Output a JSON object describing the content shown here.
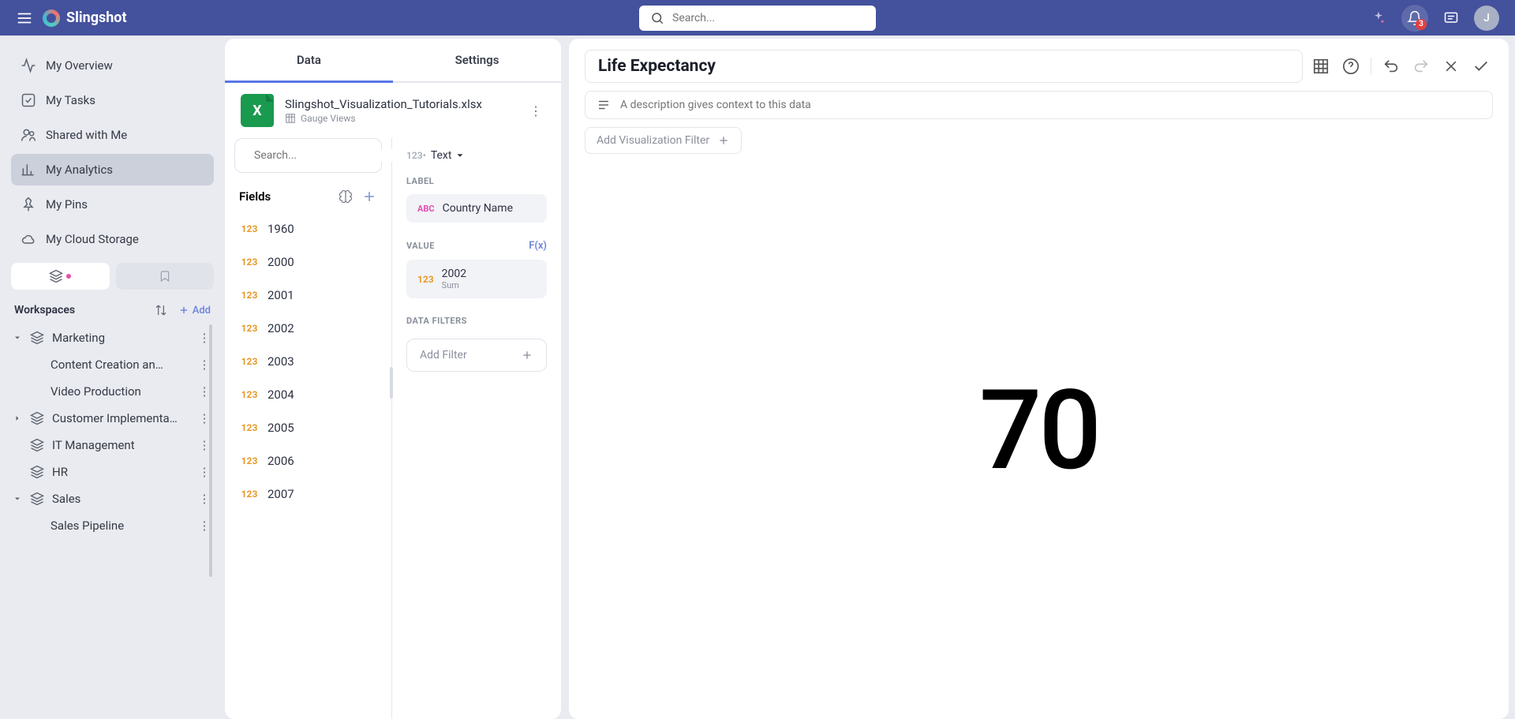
{
  "chart_data": {
    "type": "text-gauge",
    "title": "Life Expectancy",
    "label_field": "Country Name",
    "value_field": "2002",
    "aggregation": "Sum",
    "value": 70
  },
  "header": {
    "brand": "Slingshot",
    "search_placeholder": "Search...",
    "notification_count": "3",
    "avatar_initial": "J"
  },
  "sidebar": {
    "nav": [
      {
        "label": "My Overview"
      },
      {
        "label": "My Tasks"
      },
      {
        "label": "Shared with Me"
      },
      {
        "label": "My Analytics",
        "active": true
      },
      {
        "label": "My Pins"
      },
      {
        "label": "My Cloud Storage"
      }
    ],
    "workspaces_title": "Workspaces",
    "add_label": "Add",
    "workspaces": [
      {
        "label": "Marketing",
        "expanded": true,
        "children": [
          {
            "label": "Content Creation an…"
          },
          {
            "label": "Video Production"
          }
        ]
      },
      {
        "label": "Customer Implementa…",
        "expandable": true
      },
      {
        "label": "IT Management"
      },
      {
        "label": "HR"
      },
      {
        "label": "Sales",
        "expanded": true,
        "children": [
          {
            "label": "Sales Pipeline"
          }
        ]
      }
    ]
  },
  "data_panel": {
    "tabs": {
      "data": "Data",
      "settings": "Settings"
    },
    "datasource": {
      "filename": "Slingshot_Visualization_Tutorials.xlsx",
      "sheet": "Gauge Views"
    },
    "field_search_placeholder": "Search...",
    "fields_header": "Fields",
    "field_type_tag": "123",
    "fields": [
      "1960",
      "2000",
      "2001",
      "2002",
      "2003",
      "2004",
      "2005",
      "2006",
      "2007"
    ],
    "viz_type_prefix": "123•",
    "viz_type": "Text",
    "section_label": "LABEL",
    "label_chip_tag": "ABC",
    "label_chip_text": "Country Name",
    "section_value": "VALUE",
    "fx": "F(x)",
    "value_chip_tag": "123",
    "value_chip_text": "2002",
    "value_chip_sub": "Sum",
    "section_filters": "DATA FILTERS",
    "add_filter": "Add Filter"
  },
  "viz": {
    "title": "Life Expectancy",
    "desc_placeholder": "A description gives context to this data",
    "add_filter": "Add Visualization Filter",
    "value": "70"
  }
}
